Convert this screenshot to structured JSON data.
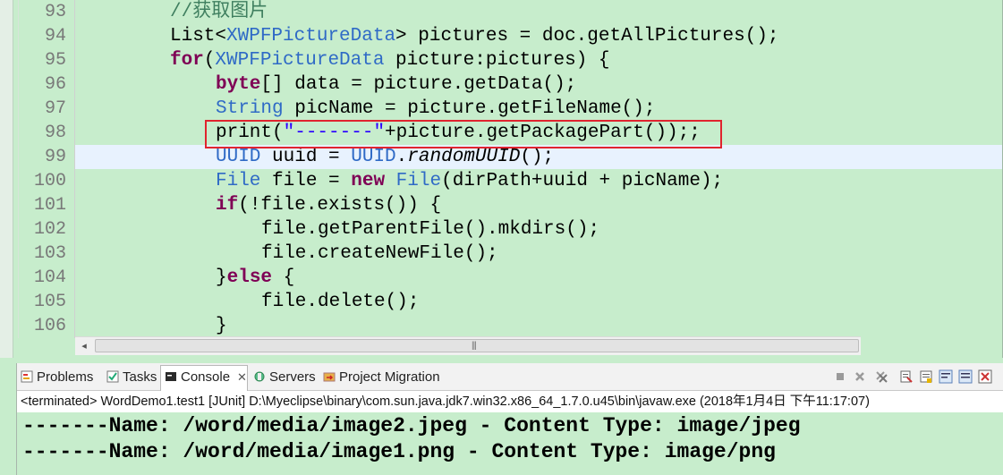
{
  "editor": {
    "line_numbers": [
      "93",
      "94",
      "95",
      "96",
      "97",
      "98",
      "99",
      "100",
      "101",
      "102",
      "103",
      "104",
      "105",
      "106"
    ],
    "lines": {
      "l93": {
        "comment": "//获取图片"
      },
      "l94": {
        "t1": "List<",
        "t2": "XWPFPictureData",
        "t3": "> pictures = doc.getAllPictures();"
      },
      "l95": {
        "kw": "for",
        "t1": "(",
        "t2": "XWPFPictureData",
        "t3": " picture:pictures) {"
      },
      "l96": {
        "kw": "byte",
        "t1": "[] data = picture.getData();"
      },
      "l97": {
        "t1": "String",
        "t2": " picName = picture.getFileName();"
      },
      "l98": {
        "t1": "print(",
        "t2": "\"-------\"",
        "t3": "+picture.getPackagePart());;"
      },
      "l99": {
        "t1": "UUID",
        "t2": " uuid = ",
        "t3": "UUID",
        "t4": ".",
        "t5": "randomUUID",
        "t6": "();"
      },
      "l100": {
        "t1": "File",
        "t2": " file = ",
        "kw": "new",
        "t3": " ",
        "t4": "File",
        "t5": "(dirPath+uuid + picName);"
      },
      "l101": {
        "kw": "if",
        "t1": "(!file.exists()) {"
      },
      "l102": {
        "t1": "file.getParentFile().mkdirs();"
      },
      "l103": {
        "t1": "file.createNewFile();"
      },
      "l104": {
        "t1": "}",
        "kw": "else",
        "t2": " {"
      },
      "l105": {
        "t1": "file.delete();"
      },
      "l106": {
        "t1": "}"
      }
    }
  },
  "scrollbar": {
    "left_arrow": "◂",
    "grip": "|||"
  },
  "console": {
    "tabs": {
      "problems": "Problems",
      "tasks": "Tasks",
      "console": "Console",
      "console_close": "✕",
      "servers": "Servers",
      "project_migration": "Project Migration"
    },
    "status": "<terminated> WordDemo1.test1 [JUnit] D:\\Myeclipse\\binary\\com.sun.java.jdk7.win32.x86_64_1.7.0.u45\\bin\\javaw.exe (2018年1月4日 下午11:17:07)",
    "output": [
      "-------Name: /word/media/image2.jpeg - Content Type: image/jpeg",
      "-------Name: /word/media/image1.png - Content Type: image/png"
    ]
  },
  "colors": {
    "editor_bg": "#c7edcc",
    "keyword": "#7f0055",
    "type": "#2f6ac6",
    "comment": "#3f7f5f",
    "string": "#2a00ff",
    "current_line": "#e8f2fe",
    "highlight_box": "#e0242e"
  }
}
